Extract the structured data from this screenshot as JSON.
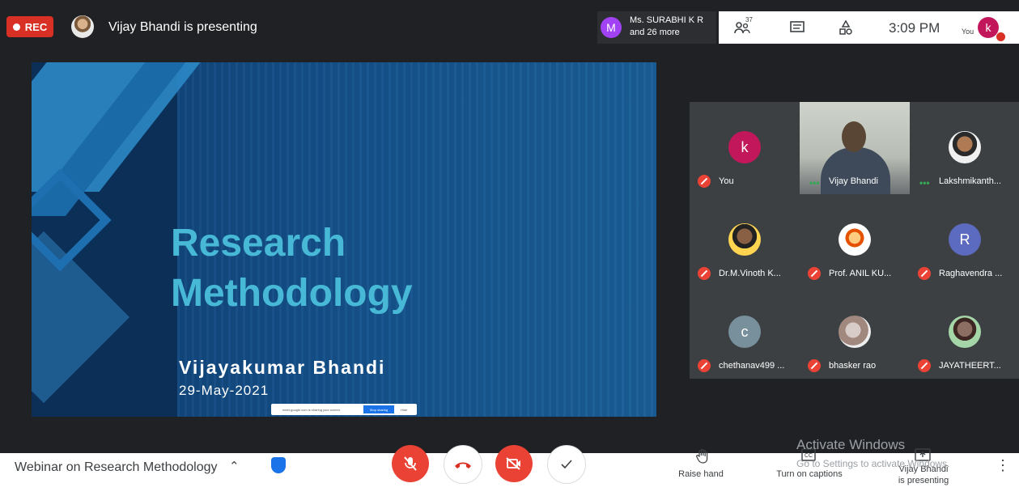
{
  "topbar": {
    "rec_label": "REC",
    "presenting": "Vijay Bhandi is presenting",
    "people_line1": "Ms. SURABHI K R",
    "people_line2": "and 26 more",
    "people_avatar": "M",
    "participant_count": "37",
    "clock": "3:09 PM",
    "you_label": "You",
    "self_initial": "k"
  },
  "slide": {
    "title_line1": "Research",
    "title_line2": "Methodology",
    "author": "Vijayakumar Bhandi",
    "date": "29-May-2021",
    "share_text": "meet.google.com is sharing your screen.",
    "stop_sharing": "Stop sharing",
    "hide": "Hide"
  },
  "participants": [
    {
      "name": "You",
      "initial": "k",
      "color": "#c2185b",
      "muted": true
    },
    {
      "name": "Vijay Bhandi",
      "video": true,
      "speaking": true
    },
    {
      "name": "Lakshmikanth...",
      "photo": true,
      "speaking": true
    },
    {
      "name": "Dr.M.Vinoth K...",
      "photo": true,
      "muted": true
    },
    {
      "name": "Prof. ANIL KU...",
      "photo": true,
      "muted": true
    },
    {
      "name": "Raghavendra ...",
      "initial": "R",
      "color": "#5c6bc0",
      "muted": true
    },
    {
      "name": "chethanav499 ...",
      "initial": "c",
      "color": "#78909c",
      "muted": true
    },
    {
      "name": "bhasker rao",
      "photo": true,
      "muted": true
    },
    {
      "name": "JAYATHEERT...",
      "photo": true,
      "muted": true
    }
  ],
  "bottom": {
    "meeting_name": "Webinar on Research Methodology",
    "raise_hand": "Raise hand",
    "captions": "Turn on captions",
    "present_line1": "Vijay Bhandi",
    "present_line2": "is presenting",
    "watermark_title": "Activate Windows",
    "watermark_sub": "Go to Settings to activate Windows."
  }
}
